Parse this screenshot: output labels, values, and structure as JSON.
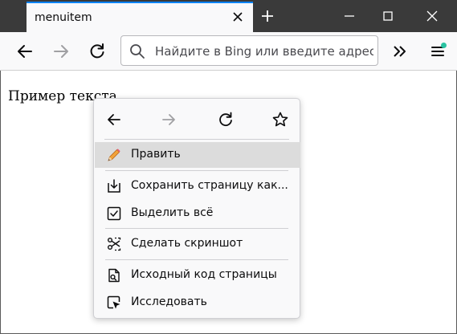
{
  "tab": {
    "title": "menuitem"
  },
  "toolbar": {
    "search_placeholder": "Найдите в Bing или введите адрес"
  },
  "content": {
    "text": "Пример текста"
  },
  "context_menu": {
    "nav": [
      "back-icon",
      "forward-icon",
      "reload-icon",
      "bookmark-star-icon"
    ],
    "items": [
      {
        "label": "Править",
        "icon": "pencil-icon"
      },
      {
        "label": "Сохранить страницу как...",
        "icon": "save-page-icon"
      },
      {
        "label": "Выделить всё",
        "icon": "select-all-icon"
      },
      {
        "label": "Сделать скриншот",
        "icon": "screenshot-icon"
      },
      {
        "label": "Исходный код страницы",
        "icon": "page-source-icon"
      },
      {
        "label": "Исследовать",
        "icon": "inspect-icon"
      }
    ]
  },
  "colors": {
    "accent": "#0a84ff",
    "titlebar": "#3a3a3a",
    "toolbar": "#f9f9fa",
    "menu_highlight": "#dcdcdc",
    "notification_dot": "#2ac3a2"
  }
}
